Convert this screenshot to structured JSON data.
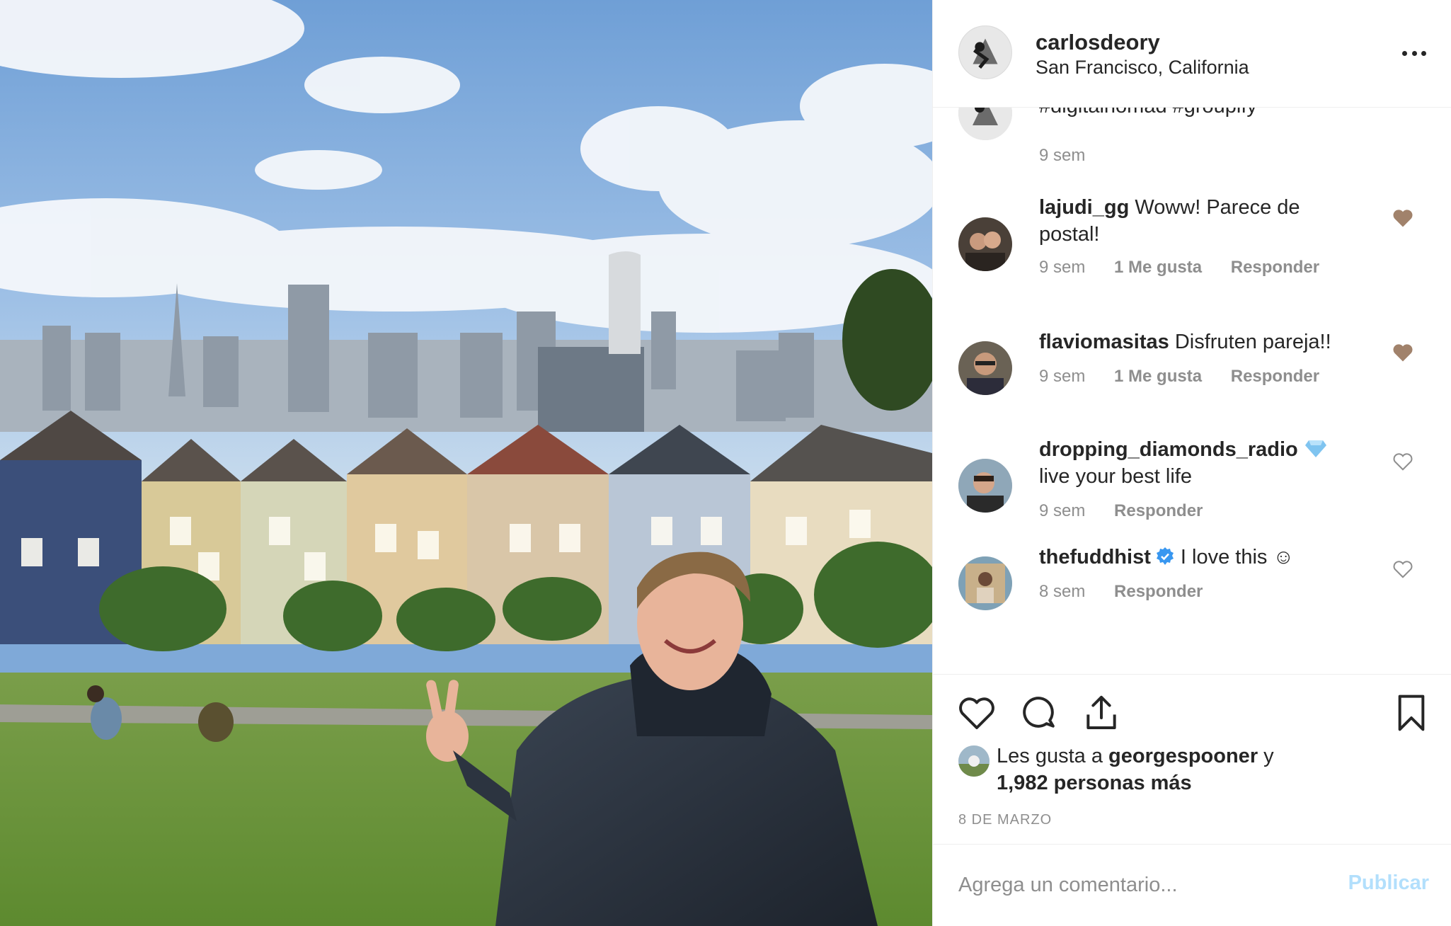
{
  "post": {
    "username": "carlosdeory",
    "location": "San Francisco, California",
    "more_icon": "more-horizontal-icon"
  },
  "caption": {
    "truncated_text": "#digitalnomad #groupify",
    "time": "9 sem"
  },
  "comments": [
    {
      "username": "lajudi_gg",
      "text": "Woww! Parece de postal!",
      "time": "9 sem",
      "likes": "1 Me gusta",
      "reply": "Responder",
      "liked": true
    },
    {
      "username": "flaviomasitas",
      "text": "Disfruten pareja!!",
      "time": "9 sem",
      "likes": "1 Me gusta",
      "reply": "Responder",
      "liked": true
    },
    {
      "username": "dropping_diamonds_radio",
      "badge": "diamond-emoji",
      "text": "live your best life",
      "time": "9 sem",
      "reply": "Responder",
      "liked": false
    },
    {
      "username": "thefuddhist",
      "badge": "verified-badge",
      "text": "I love this ☺",
      "time": "8 sem",
      "reply": "Responder",
      "liked": false
    }
  ],
  "actions": {
    "like_icon": "heart-outline-icon",
    "comment_icon": "comment-bubble-icon",
    "share_icon": "share-upload-icon",
    "save_icon": "bookmark-icon"
  },
  "likes": {
    "prefix": "Les gusta a",
    "user": "georgespooner",
    "conjunction": "y",
    "others": "1,982 personas más"
  },
  "date": "8 DE MARZO",
  "compose": {
    "placeholder": "Agrega un comentario...",
    "publish_label": "Publicar"
  },
  "colors": {
    "liked_heart": "#a1826b",
    "link_disabled": "#b2dffc",
    "secondary_text": "#8e8e8e",
    "primary_text": "#262626",
    "verified": "#3897f0"
  }
}
